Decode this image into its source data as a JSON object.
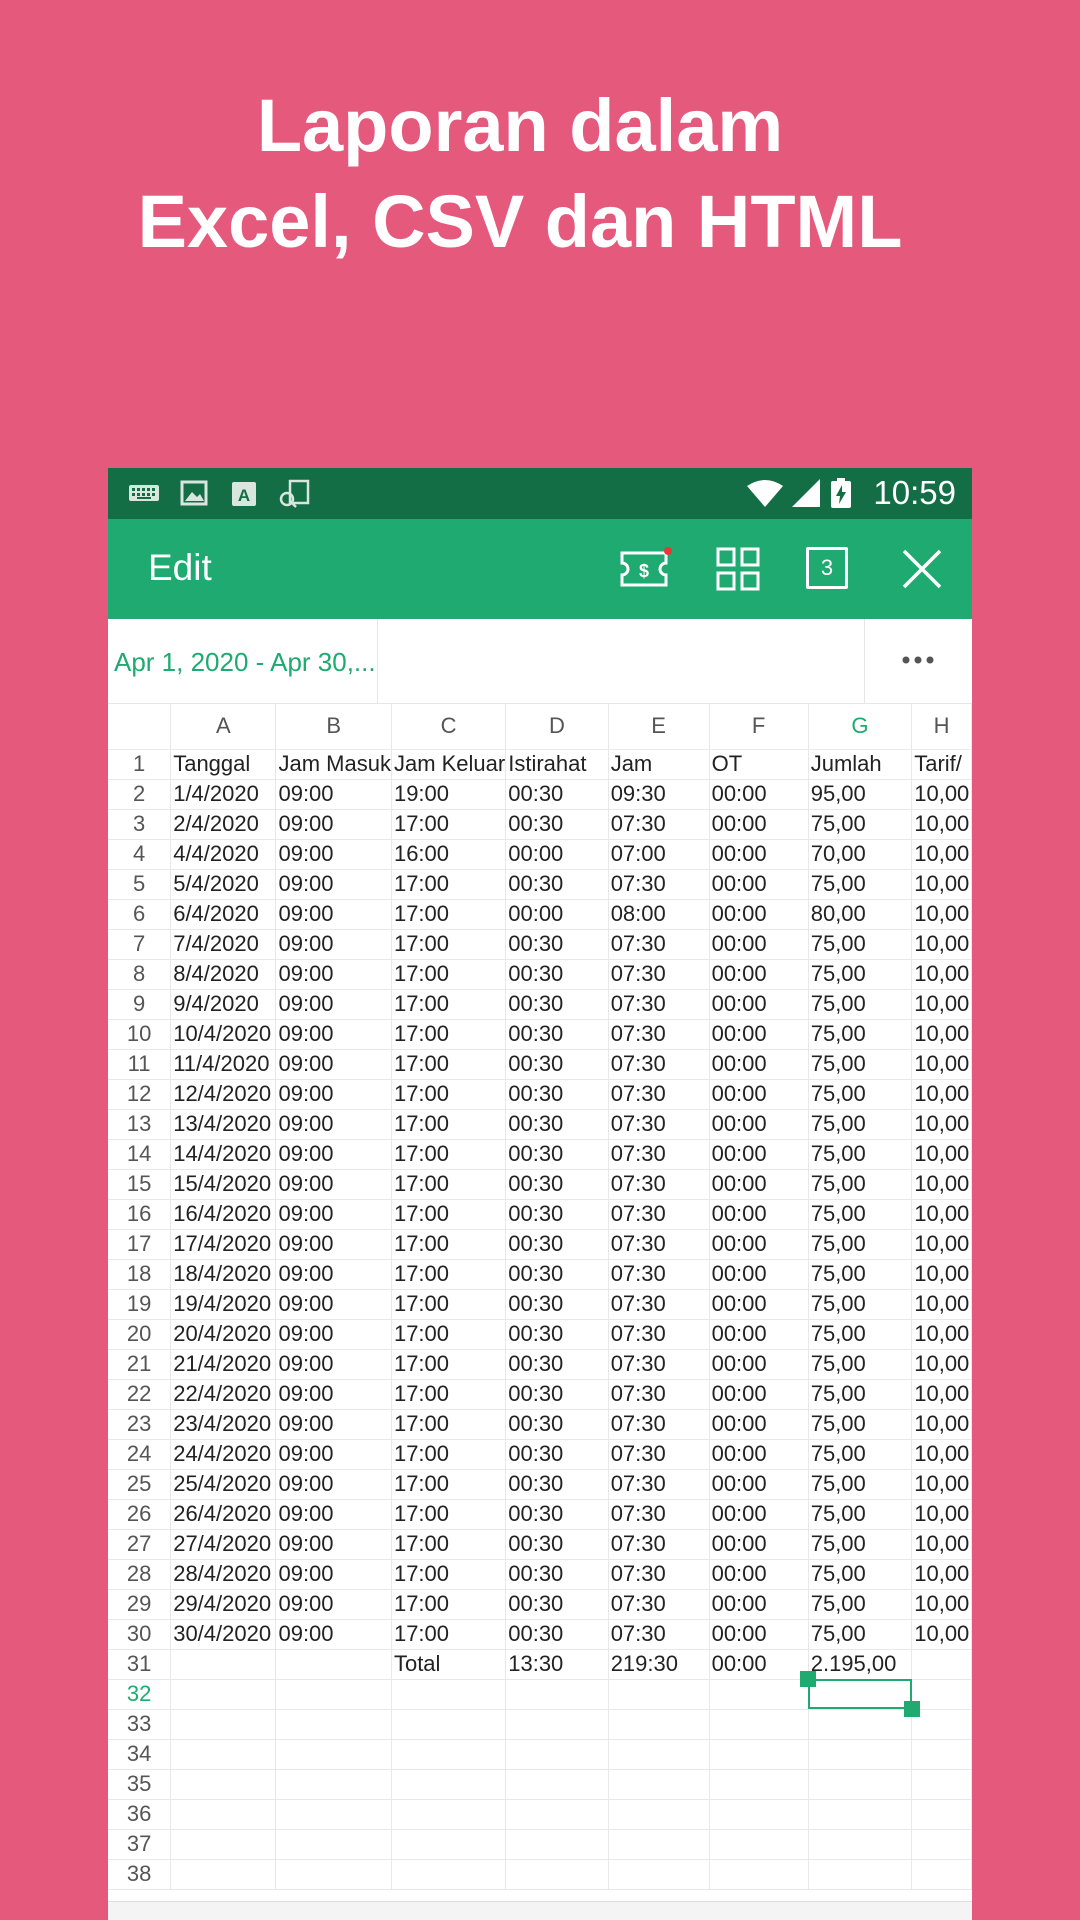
{
  "promo": {
    "line1": "Laporan dalam",
    "line2": "Excel, CSV dan HTML"
  },
  "statusbar": {
    "time": "10:59",
    "icons": [
      "keyboard-icon",
      "image-icon",
      "font-a-icon",
      "clipboard-icon",
      "wifi-icon",
      "signal-icon",
      "battery-charging-icon"
    ]
  },
  "appbar": {
    "title": "Edit",
    "page_badge": "3",
    "actions": [
      "currency-ticket-icon",
      "grid-icon",
      "page-count-icon",
      "close-icon"
    ],
    "accent": "#1eaa70",
    "status_color": "#136d45",
    "notification_dot": "#e53935"
  },
  "toolbar": {
    "date_range": "Apr 1, 2020 - Apr 30,..."
  },
  "sheet": {
    "columns": [
      "A",
      "B",
      "C",
      "D",
      "E",
      "F",
      "G",
      "H"
    ],
    "header_row": [
      "Tanggal",
      "Jam Masuk",
      "Jam Keluar",
      "Istirahat",
      "Jam",
      "OT",
      "Jumlah",
      "Tarif/"
    ],
    "rows": [
      [
        "1/4/2020",
        "09:00",
        "19:00",
        "00:30",
        "09:30",
        "00:00",
        "95,00",
        "10,00"
      ],
      [
        "2/4/2020",
        "09:00",
        "17:00",
        "00:30",
        "07:30",
        "00:00",
        "75,00",
        "10,00"
      ],
      [
        "4/4/2020",
        "09:00",
        "16:00",
        "00:00",
        "07:00",
        "00:00",
        "70,00",
        "10,00"
      ],
      [
        "5/4/2020",
        "09:00",
        "17:00",
        "00:30",
        "07:30",
        "00:00",
        "75,00",
        "10,00"
      ],
      [
        "6/4/2020",
        "09:00",
        "17:00",
        "00:00",
        "08:00",
        "00:00",
        "80,00",
        "10,00"
      ],
      [
        "7/4/2020",
        "09:00",
        "17:00",
        "00:30",
        "07:30",
        "00:00",
        "75,00",
        "10,00"
      ],
      [
        "8/4/2020",
        "09:00",
        "17:00",
        "00:30",
        "07:30",
        "00:00",
        "75,00",
        "10,00"
      ],
      [
        "9/4/2020",
        "09:00",
        "17:00",
        "00:30",
        "07:30",
        "00:00",
        "75,00",
        "10,00"
      ],
      [
        "10/4/2020",
        "09:00",
        "17:00",
        "00:30",
        "07:30",
        "00:00",
        "75,00",
        "10,00"
      ],
      [
        "11/4/2020",
        "09:00",
        "17:00",
        "00:30",
        "07:30",
        "00:00",
        "75,00",
        "10,00"
      ],
      [
        "12/4/2020",
        "09:00",
        "17:00",
        "00:30",
        "07:30",
        "00:00",
        "75,00",
        "10,00"
      ],
      [
        "13/4/2020",
        "09:00",
        "17:00",
        "00:30",
        "07:30",
        "00:00",
        "75,00",
        "10,00"
      ],
      [
        "14/4/2020",
        "09:00",
        "17:00",
        "00:30",
        "07:30",
        "00:00",
        "75,00",
        "10,00"
      ],
      [
        "15/4/2020",
        "09:00",
        "17:00",
        "00:30",
        "07:30",
        "00:00",
        "75,00",
        "10,00"
      ],
      [
        "16/4/2020",
        "09:00",
        "17:00",
        "00:30",
        "07:30",
        "00:00",
        "75,00",
        "10,00"
      ],
      [
        "17/4/2020",
        "09:00",
        "17:00",
        "00:30",
        "07:30",
        "00:00",
        "75,00",
        "10,00"
      ],
      [
        "18/4/2020",
        "09:00",
        "17:00",
        "00:30",
        "07:30",
        "00:00",
        "75,00",
        "10,00"
      ],
      [
        "19/4/2020",
        "09:00",
        "17:00",
        "00:30",
        "07:30",
        "00:00",
        "75,00",
        "10,00"
      ],
      [
        "20/4/2020",
        "09:00",
        "17:00",
        "00:30",
        "07:30",
        "00:00",
        "75,00",
        "10,00"
      ],
      [
        "21/4/2020",
        "09:00",
        "17:00",
        "00:30",
        "07:30",
        "00:00",
        "75,00",
        "10,00"
      ],
      [
        "22/4/2020",
        "09:00",
        "17:00",
        "00:30",
        "07:30",
        "00:00",
        "75,00",
        "10,00"
      ],
      [
        "23/4/2020",
        "09:00",
        "17:00",
        "00:30",
        "07:30",
        "00:00",
        "75,00",
        "10,00"
      ],
      [
        "24/4/2020",
        "09:00",
        "17:00",
        "00:30",
        "07:30",
        "00:00",
        "75,00",
        "10,00"
      ],
      [
        "25/4/2020",
        "09:00",
        "17:00",
        "00:30",
        "07:30",
        "00:00",
        "75,00",
        "10,00"
      ],
      [
        "26/4/2020",
        "09:00",
        "17:00",
        "00:30",
        "07:30",
        "00:00",
        "75,00",
        "10,00"
      ],
      [
        "27/4/2020",
        "09:00",
        "17:00",
        "00:30",
        "07:30",
        "00:00",
        "75,00",
        "10,00"
      ],
      [
        "28/4/2020",
        "09:00",
        "17:00",
        "00:30",
        "07:30",
        "00:00",
        "75,00",
        "10,00"
      ],
      [
        "29/4/2020",
        "09:00",
        "17:00",
        "00:30",
        "07:30",
        "00:00",
        "75,00",
        "10,00"
      ],
      [
        "30/4/2020",
        "09:00",
        "17:00",
        "00:30",
        "07:30",
        "00:00",
        "75,00",
        "10,00"
      ]
    ],
    "total_row": [
      "",
      "",
      "Total",
      "13:30",
      "219:30",
      "00:00",
      "2.195,00",
      ""
    ],
    "row_numbers": [
      "1",
      "2",
      "3",
      "4",
      "5",
      "6",
      "7",
      "8",
      "9",
      "10",
      "11",
      "12",
      "13",
      "14",
      "15",
      "16",
      "17",
      "18",
      "19",
      "20",
      "21",
      "22",
      "23",
      "24",
      "25",
      "26",
      "27",
      "28",
      "29",
      "30",
      "31",
      "32",
      "33",
      "34",
      "35",
      "36",
      "37",
      "38"
    ],
    "active_column": "G",
    "active_row": "32"
  }
}
